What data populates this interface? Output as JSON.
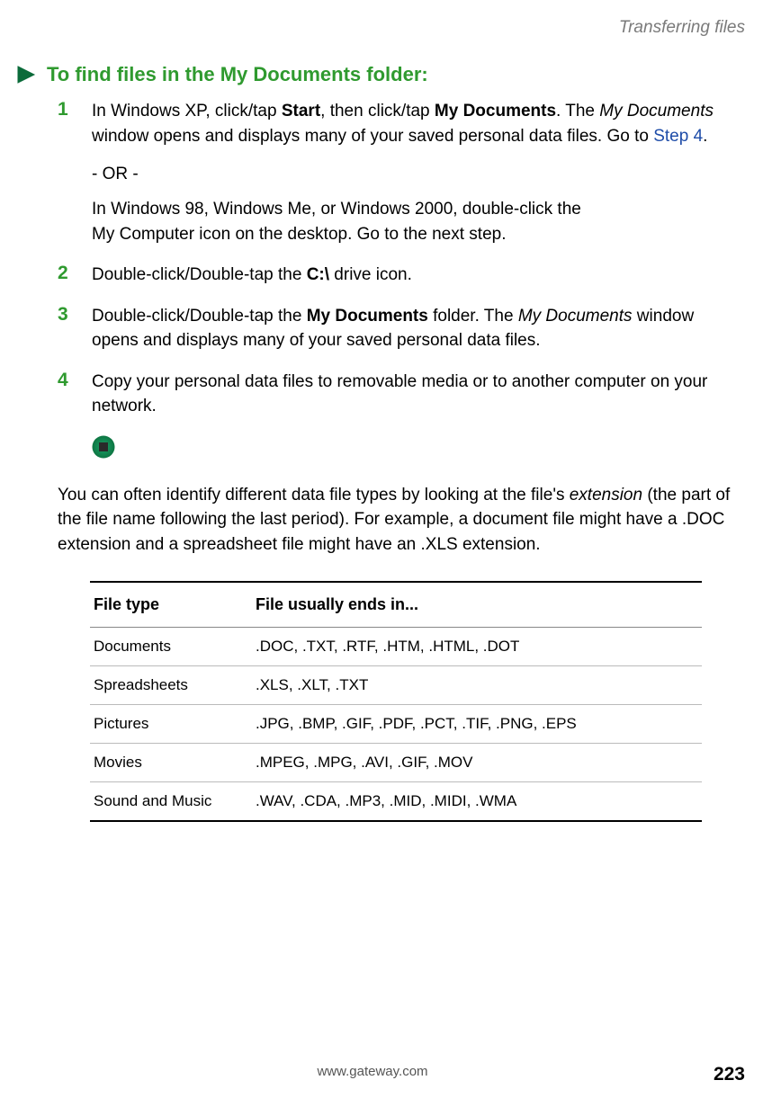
{
  "header": {
    "section_label": "Transferring files"
  },
  "heading": "To find files in the My Documents folder:",
  "steps": {
    "s1": {
      "num": "1",
      "t1": "In Windows XP, click/tap ",
      "b1": "Start",
      "t2": ", then click/tap ",
      "b2": "My Documents",
      "t3": ". The ",
      "i1": "My Documents",
      "t4": " window opens and displays many of your saved personal data files. Go to ",
      "link": "Step 4",
      "t5": "."
    },
    "or": "- OR -",
    "s1b": {
      "t1": "In Windows 98, Windows Me, or Windows 2000, double-click the ",
      "b1": "My Computer",
      "t2": " icon on the desktop. Go to the next step."
    },
    "s2": {
      "num": "2",
      "t1": "Double-click/Double-tap the ",
      "m1": "C:\\",
      "t2": " drive icon."
    },
    "s3": {
      "num": "3",
      "t1": "Double-click/Double-tap the ",
      "b1": "My Documents",
      "t2": " folder. The ",
      "i1": "My Documents",
      "t3": " window opens and displays many of your saved personal data files."
    },
    "s4": {
      "num": "4",
      "t1": "Copy your personal data files to removable media or to another computer on your network."
    }
  },
  "paragraph": {
    "t1": "You can often identify different data file types by looking at the file's ",
    "i1": "extension",
    "t2": " (the part of the file name following the last period). For example, a document file might have a .DOC extension and a spreadsheet file might have an .XLS extension."
  },
  "table": {
    "headers": {
      "c1": "File type",
      "c2": "File usually ends in..."
    },
    "rows": [
      {
        "c1": "Documents",
        "c2": ".DOC, .TXT, .RTF, .HTM, .HTML, .DOT"
      },
      {
        "c1": "Spreadsheets",
        "c2": ".XLS, .XLT, .TXT"
      },
      {
        "c1": "Pictures",
        "c2": ".JPG, .BMP, .GIF, .PDF, .PCT, .TIF, .PNG, .EPS"
      },
      {
        "c1": "Movies",
        "c2": ".MPEG, .MPG, .AVI, .GIF, .MOV"
      },
      {
        "c1": "Sound and Music",
        "c2": ".WAV, .CDA, .MP3, .MID, .MIDI, .WMA"
      }
    ]
  },
  "footer": {
    "url": "www.gateway.com",
    "page": "223"
  }
}
